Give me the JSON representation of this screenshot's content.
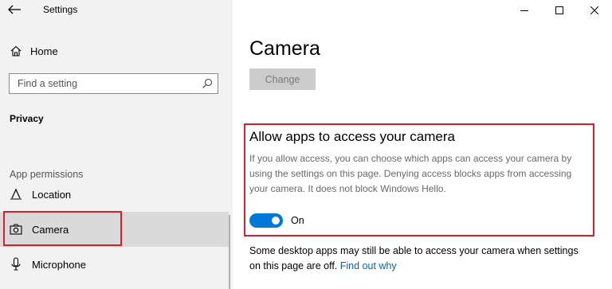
{
  "window": {
    "app_title": "Settings",
    "controls": [
      "minimize-icon",
      "maximize-icon",
      "close-icon"
    ]
  },
  "sidebar": {
    "home_label": "Home",
    "search": {
      "placeholder": "Find a setting",
      "value": ""
    },
    "section_heading": "Privacy",
    "group_label": "App permissions",
    "items": [
      {
        "label": "Location",
        "icon": "location-icon",
        "selected": false
      },
      {
        "label": "Camera",
        "icon": "camera-icon",
        "selected": true
      },
      {
        "label": "Microphone",
        "icon": "microphone-icon",
        "selected": false
      }
    ]
  },
  "main": {
    "page_title": "Camera",
    "change_button": "Change",
    "section": {
      "title": "Allow apps to access your camera",
      "description": "If you allow access, you can choose which apps can access your camera by using the settings on this page. Denying access blocks apps from accessing your camera. It does not block Windows Hello.",
      "toggle_state": "On",
      "toggle_on": true
    },
    "note": {
      "text": "Some desktop apps may still be able to access your camera when settings on this page are off. ",
      "link": "Find out why"
    }
  },
  "colors": {
    "accent": "#0078d7",
    "highlight": "#d8202b",
    "link": "#0066b4",
    "sidebar_bg": "#f2f2f2",
    "selected_bg": "#dadada"
  }
}
